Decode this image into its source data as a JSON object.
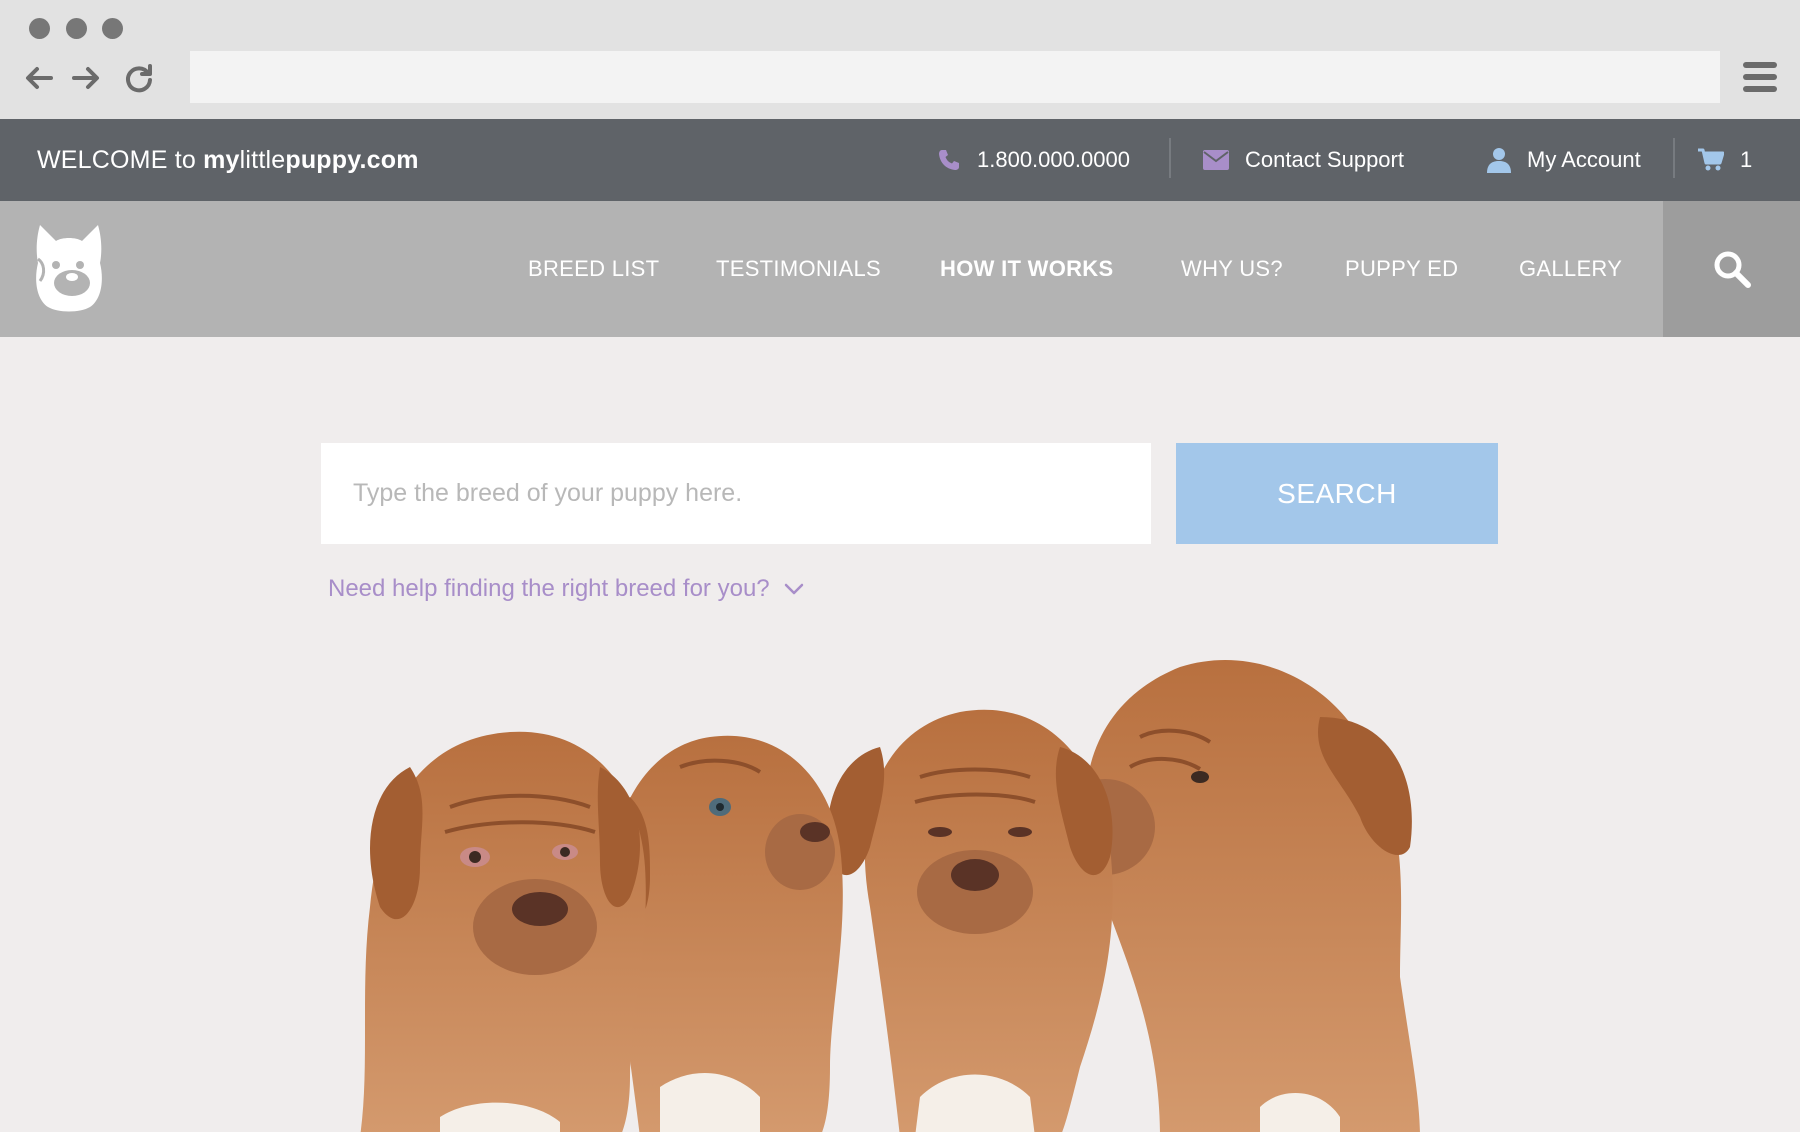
{
  "browser": {
    "url": "",
    "icons": {
      "back": "arrow-left-icon",
      "forward": "arrow-right-icon",
      "reload": "reload-icon",
      "menu": "hamburger-menu-icon"
    }
  },
  "topbar": {
    "welcome_prefix": "WELCOME to ",
    "domain_my": "my",
    "domain_little": "little",
    "domain_puppy": "puppy.com",
    "phone": "1.800.000.0000",
    "support": "Contact Support",
    "account": "My Account",
    "cart_count": "1",
    "icon_color": "#a88ec9",
    "account_icon_color": "#a3c7ea"
  },
  "nav": {
    "items": [
      {
        "label": "BREED LIST",
        "active": false
      },
      {
        "label": "TESTIMONIALS",
        "active": false
      },
      {
        "label": "HOW IT WORKS",
        "active": true
      },
      {
        "label": "WHY US?",
        "active": false
      },
      {
        "label": "PUPPY ED",
        "active": false
      },
      {
        "label": "GALLERY",
        "active": false
      }
    ]
  },
  "search": {
    "placeholder": "Type the breed of your puppy here.",
    "value": "",
    "button_label": "SEARCH",
    "help_text": "Need help finding the right breed for you?"
  },
  "hero": {
    "image_subject": "four dogue de bordeaux puppies",
    "fur_color": "#c07a4e"
  }
}
